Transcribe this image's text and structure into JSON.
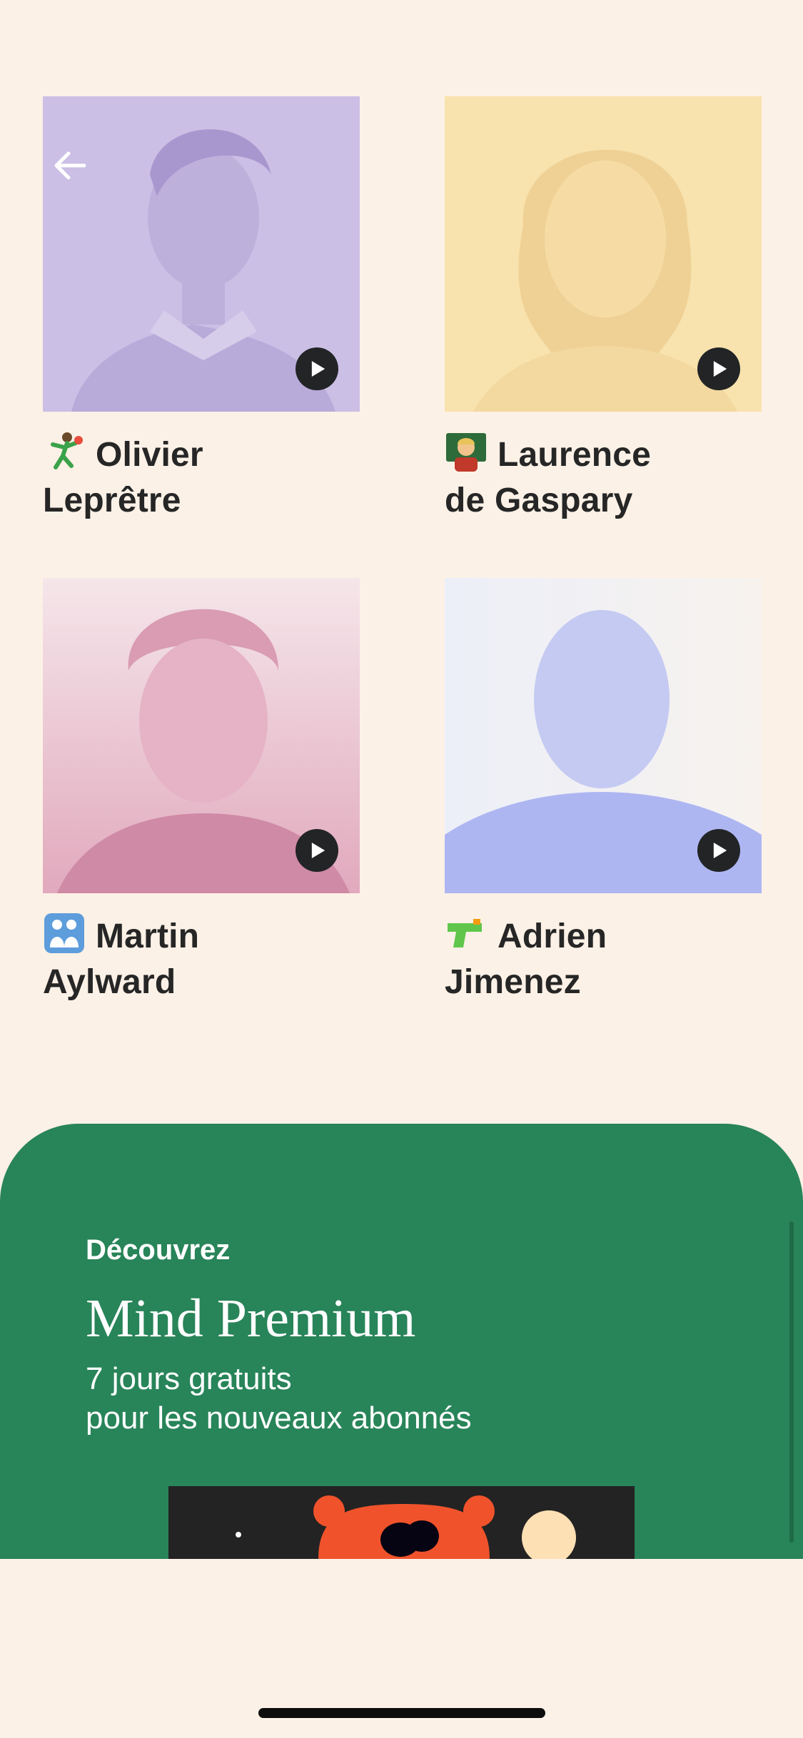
{
  "navigation": {
    "back_icon": "arrow-left-icon"
  },
  "teachers": [
    {
      "first": "Olivier",
      "last": "Leprêtre",
      "emoji": "handball-player",
      "tint": "#cdc1e6"
    },
    {
      "first": "Laurence",
      "last": "de Gaspary",
      "emoji": "teacher",
      "tint": "#f8e1aa"
    },
    {
      "first": "Martin",
      "last": "Aylward",
      "emoji": "family",
      "tint": "#e7b8cb"
    },
    {
      "first": "Adrien",
      "last": "Jimenez",
      "emoji": "water-pistol",
      "tint": "#c6cbf6"
    }
  ],
  "play_icon": "play-icon",
  "promo": {
    "kicker": "Découvrez",
    "title": "Mind Premium",
    "subtitle_line1": "7 jours gratuits",
    "subtitle_line2": "pour les nouveaux abonnés",
    "color": "#288459"
  }
}
